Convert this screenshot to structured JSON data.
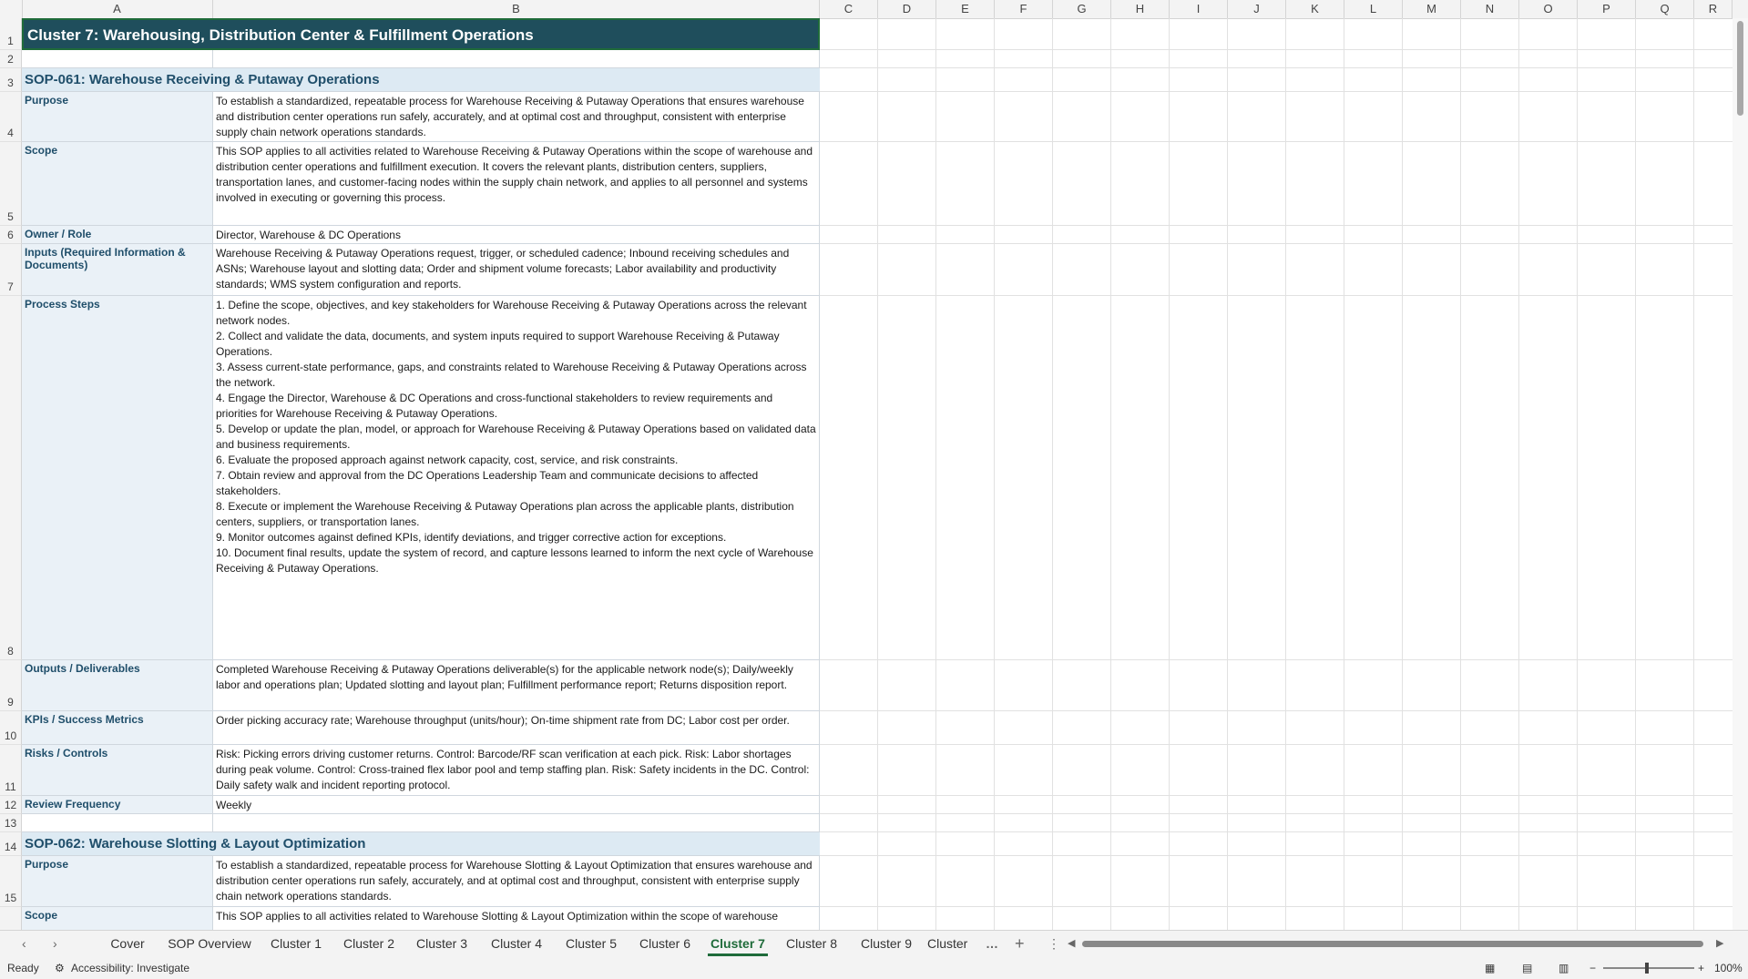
{
  "columns": [
    "A",
    "B",
    "C",
    "D",
    "E",
    "F",
    "G",
    "H",
    "I",
    "J",
    "K",
    "L",
    "M",
    "N",
    "O",
    "P",
    "Q",
    "R"
  ],
  "title": "Cluster 7: Warehousing, Distribution Center & Fulfillment Operations",
  "sop61": {
    "heading": "SOP-061: Warehouse Receiving & Putaway Operations",
    "purpose_label": "Purpose",
    "purpose": "To establish a standardized, repeatable process for Warehouse Receiving & Putaway Operations that ensures warehouse and distribution center operations run safely, accurately, and at optimal cost and throughput, consistent with enterprise supply chain network operations standards.",
    "scope_label": "Scope",
    "scope": "This SOP applies to all activities related to Warehouse Receiving & Putaway Operations within the scope of warehouse and distribution center operations and fulfillment execution. It covers the relevant plants, distribution centers, suppliers, transportation lanes, and customer-facing nodes within the supply chain network, and applies to all personnel and systems involved in executing or governing this process.",
    "owner_label": "Owner / Role",
    "owner": "Director, Warehouse & DC Operations",
    "inputs_label": "Inputs (Required Information & Documents)",
    "inputs": "Warehouse Receiving & Putaway Operations request, trigger, or scheduled cadence; Inbound receiving schedules and ASNs; Warehouse layout and slotting data; Order and shipment volume forecasts; Labor availability and productivity standards; WMS system configuration and reports.",
    "steps_label": "Process Steps",
    "steps": [
      "1. Define the scope, objectives, and key stakeholders for Warehouse Receiving & Putaway Operations across the relevant network nodes.",
      "2. Collect and validate the data, documents, and system inputs required to support Warehouse Receiving & Putaway Operations.",
      "3. Assess current-state performance, gaps, and constraints related to Warehouse Receiving & Putaway Operations across the network.",
      "4. Engage the Director, Warehouse & DC Operations and cross-functional stakeholders to review requirements and priorities for Warehouse Receiving & Putaway Operations.",
      "5. Develop or update the plan, model, or approach for Warehouse Receiving & Putaway Operations based on validated data and business requirements.",
      "6. Evaluate the proposed approach against network capacity, cost, service, and risk constraints.",
      "7. Obtain review and approval from the DC Operations Leadership Team and communicate decisions to affected stakeholders.",
      "8. Execute or implement the Warehouse Receiving & Putaway Operations plan across the applicable plants, distribution centers, suppliers, or transportation lanes.",
      "9. Monitor outcomes against defined KPIs, identify deviations, and trigger corrective action for exceptions.",
      "10. Document final results, update the system of record, and capture lessons learned to inform the next cycle of Warehouse Receiving & Putaway Operations."
    ],
    "outputs_label": "Outputs / Deliverables",
    "outputs": "Completed Warehouse Receiving & Putaway Operations deliverable(s) for the applicable network node(s); Daily/weekly labor and operations plan; Updated slotting and layout plan; Fulfillment performance report; Returns disposition report.",
    "kpis_label": "KPIs / Success Metrics",
    "kpis": "Order picking accuracy rate; Warehouse throughput (units/hour); On-time shipment rate from DC; Labor cost per order.",
    "risks_label": "Risks / Controls",
    "risks": "Risk: Picking errors driving customer returns. Control: Barcode/RF scan verification at each pick. Risk: Labor shortages during peak volume. Control: Cross-trained flex labor pool and temp staffing plan. Risk: Safety incidents in the DC. Control: Daily safety walk and incident reporting protocol.",
    "review_label": "Review Frequency",
    "review": "Weekly"
  },
  "sop62": {
    "heading": "SOP-062: Warehouse Slotting & Layout Optimization",
    "purpose_label": "Purpose",
    "purpose": "To establish a standardized, repeatable process for Warehouse Slotting & Layout Optimization that ensures warehouse and distribution center operations run safely, accurately, and at optimal cost and throughput, consistent with enterprise supply chain network operations standards.",
    "scope_label": "Scope",
    "scope": "This SOP applies to all activities related to Warehouse Slotting & Layout Optimization within the scope of warehouse"
  },
  "tabs": [
    "Cover",
    "SOP Overview",
    "Cluster 1",
    "Cluster 2",
    "Cluster 3",
    "Cluster 4",
    "Cluster 5",
    "Cluster 6",
    "Cluster 7",
    "Cluster 8",
    "Cluster 9",
    "Cluster"
  ],
  "active_tab": "Cluster 7",
  "status": {
    "ready": "Ready",
    "accessibility": "Accessibility: Investigate",
    "zoom": "100%"
  }
}
